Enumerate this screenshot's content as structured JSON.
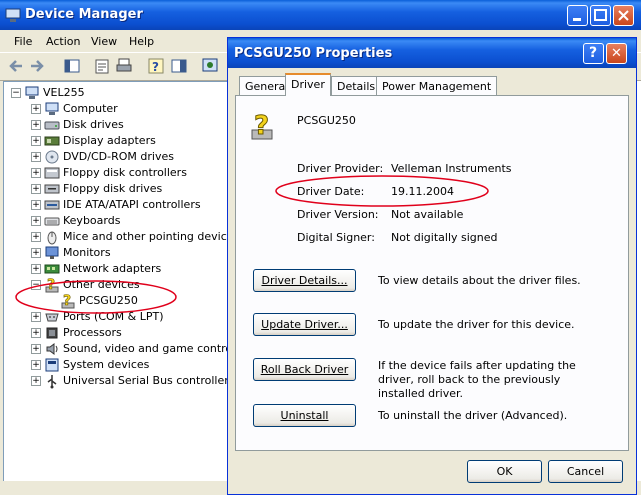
{
  "device_manager": {
    "title": "Device Manager",
    "menu": [
      "File",
      "Action",
      "View",
      "Help"
    ],
    "tree": {
      "root": "VEL255",
      "items": [
        {
          "label": "Computer",
          "icon": "computer-icon"
        },
        {
          "label": "Disk drives",
          "icon": "disk-drive-icon"
        },
        {
          "label": "Display adapters",
          "icon": "display-adapter-icon"
        },
        {
          "label": "DVD/CD-ROM drives",
          "icon": "cdrom-icon"
        },
        {
          "label": "Floppy disk controllers",
          "icon": "floppy-controller-icon"
        },
        {
          "label": "Floppy disk drives",
          "icon": "floppy-drive-icon"
        },
        {
          "label": "IDE ATA/ATAPI controllers",
          "icon": "ide-controller-icon"
        },
        {
          "label": "Keyboards",
          "icon": "keyboard-icon"
        },
        {
          "label": "Mice and other pointing devices",
          "icon": "mouse-icon"
        },
        {
          "label": "Monitors",
          "icon": "monitor-icon"
        },
        {
          "label": "Network adapters",
          "icon": "network-adapter-icon"
        },
        {
          "label": "Other devices",
          "icon": "unknown-device-icon"
        },
        {
          "label": "PCSGU250",
          "icon": "unknown-device-icon"
        },
        {
          "label": "Ports (COM & LPT)",
          "icon": "port-icon"
        },
        {
          "label": "Processors",
          "icon": "processor-icon"
        },
        {
          "label": "Sound, video and game controllers",
          "icon": "sound-icon"
        },
        {
          "label": "System devices",
          "icon": "system-device-icon"
        },
        {
          "label": "Universal Serial Bus controllers",
          "icon": "usb-icon"
        }
      ]
    }
  },
  "dialog": {
    "title": "PCSGU250 Properties",
    "tabs": [
      "General",
      "Driver",
      "Details",
      "Power Management"
    ],
    "device_name": "PCSGU250",
    "fields": [
      {
        "label": "Driver Provider:",
        "value": "Velleman Instruments"
      },
      {
        "label": "Driver Date:",
        "value": "19.11.2004"
      },
      {
        "label": "Driver Version:",
        "value": "Not available"
      },
      {
        "label": "Digital Signer:",
        "value": "Not digitally signed"
      }
    ],
    "actions": [
      {
        "button": "Driver Details...",
        "desc": "To view details about the driver files."
      },
      {
        "button": "Update Driver...",
        "desc": "To update the driver for this device."
      },
      {
        "button": "Roll Back Driver",
        "desc": "If the device fails after updating the driver, roll back to the previously installed driver."
      },
      {
        "button": "Uninstall",
        "desc": "To uninstall the driver (Advanced)."
      }
    ],
    "ok": "OK",
    "cancel": "Cancel",
    "help_glyph": "?",
    "close_glyph": "✕"
  },
  "colors": {
    "highlight_ring": "#e0001b",
    "title_bar": "#0a5fd8"
  }
}
